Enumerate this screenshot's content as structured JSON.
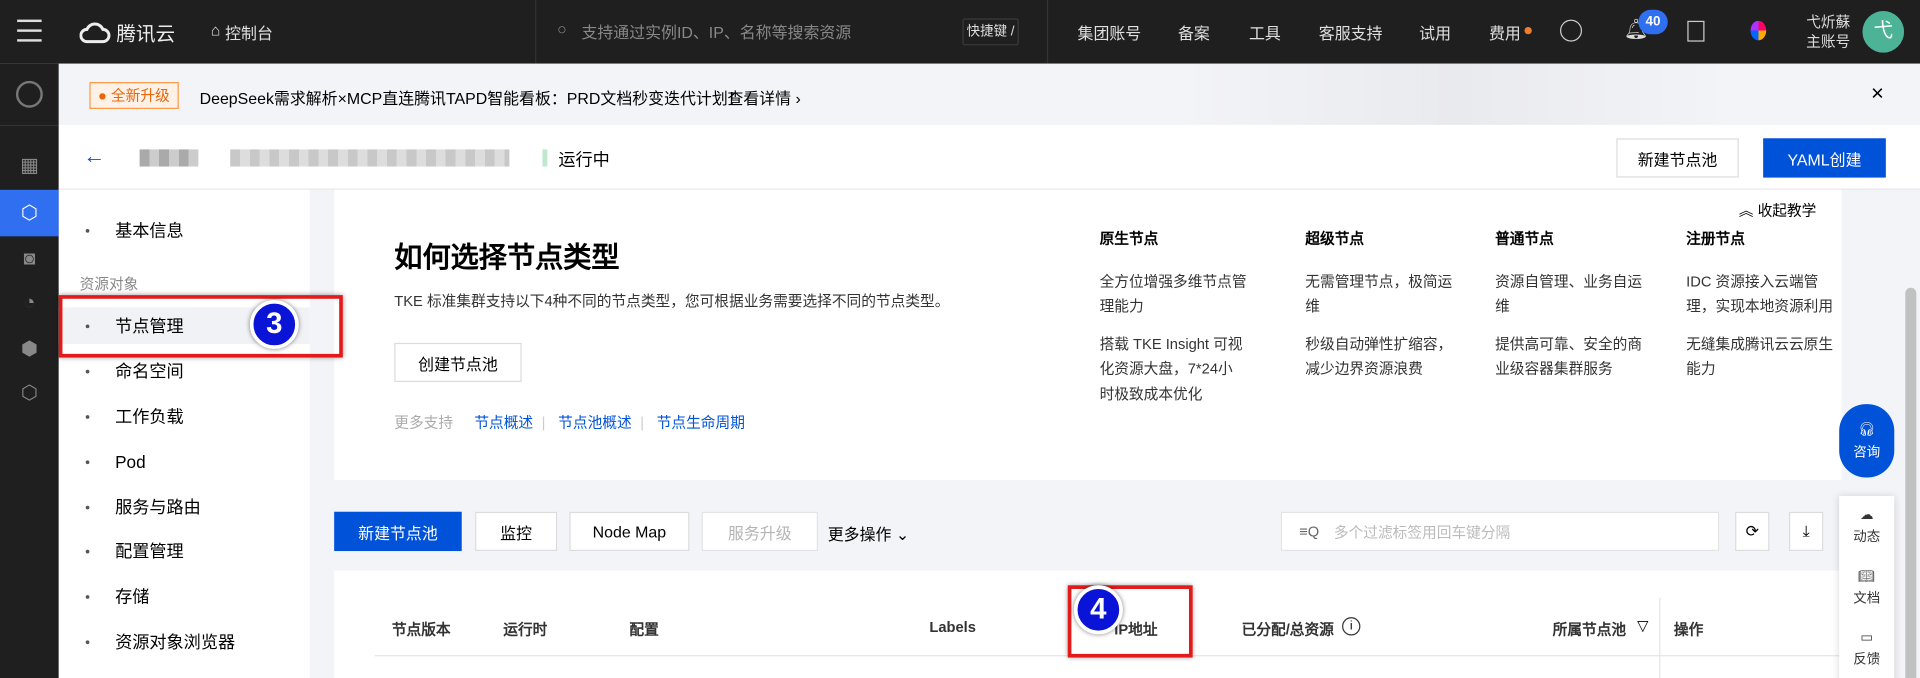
{
  "topbar": {
    "brand": "腾讯云",
    "console": "控制台",
    "search_placeholder": "支持通过实例ID、IP、名称等搜索资源",
    "shortcut": "快捷键 /",
    "nav": [
      "集团账号",
      "备案",
      "工具",
      "客服支持",
      "试用",
      "费用"
    ],
    "notification_count": "40",
    "user_name": "弋炘蘇",
    "user_role": "主账号",
    "avatar_letter": "弋"
  },
  "banner": {
    "tag": "全新升级",
    "text": "DeepSeek需求解析×MCP直连腾讯TAPD智能看板：PRD文档秒变迭代计划！",
    "link": "查看详情"
  },
  "header": {
    "status": "运行中",
    "new_pool": "新建节点池",
    "yaml_create": "YAML创建"
  },
  "sidebar": {
    "basic_info": "基本信息",
    "section": "资源对象",
    "items": [
      "节点管理",
      "命名空间",
      "工作负载",
      "Pod",
      "服务与路由",
      "配置管理",
      "存储",
      "资源对象浏览器"
    ]
  },
  "tutorial": {
    "collapse": "收起教学",
    "title": "如何选择节点类型",
    "desc": "TKE 标准集群支持以下4种不同的节点类型，您可根据业务需要选择不同的节点类型。",
    "create_button": "创建节点池",
    "more_support": "更多支持",
    "links": [
      "节点概述",
      "节点池概述",
      "节点生命周期"
    ],
    "types": [
      {
        "name": "原生节点",
        "lines": [
          "全方位增强多维节点管理能力",
          "搭载 TKE Insight 可视化资源大盘，7*24小时极致成本优化"
        ]
      },
      {
        "name": "超级节点",
        "lines": [
          "无需管理节点，极简运维",
          "秒级自动弹性扩缩容，减少边界资源浪费"
        ]
      },
      {
        "name": "普通节点",
        "lines": [
          "资源自管理、业务自运维",
          "提供高可靠、安全的商业级容器集群服务"
        ]
      },
      {
        "name": "注册节点",
        "lines": [
          "IDC 资源接入云端管理，实现本地资源利用",
          "无缝集成腾讯云云原生能力"
        ]
      }
    ]
  },
  "toolbar": {
    "new_pool": "新建节点池",
    "monitor": "监控",
    "node_map": "Node Map",
    "upgrade": "服务升级",
    "more": "更多操作",
    "filter_placeholder": "多个过滤标签用回车键分隔"
  },
  "table": {
    "columns": [
      "节点版本",
      "运行时",
      "配置",
      "Labels",
      "IP地址",
      "已分配/总资源",
      "所属节点池",
      "操作"
    ]
  },
  "annotations": {
    "step3": "3",
    "step4": "4"
  },
  "float": {
    "consult": "咨询",
    "items": [
      "动态",
      "文档",
      "反馈"
    ]
  }
}
